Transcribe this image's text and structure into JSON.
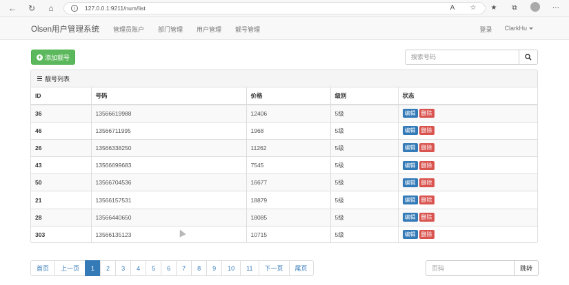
{
  "browser": {
    "url": "127.0.0.1:9211/num/list"
  },
  "navbar": {
    "brand": "Olsen用户管理系统",
    "links": [
      "管理员账户",
      "部门管理",
      "用户管理",
      "靓号管理"
    ],
    "login": "登录",
    "user": "ClarkHu"
  },
  "toolbar": {
    "add_label": "添加靓号",
    "search_placeholder": "搜索号码"
  },
  "panel": {
    "title": "靓号列表"
  },
  "table": {
    "headers": [
      "ID",
      "号码",
      "价格",
      "级别",
      "状态"
    ],
    "edit_label": "编辑",
    "delete_label": "删除",
    "rows": [
      {
        "id": "36",
        "mobile": "13566619988",
        "price": "12406",
        "level": "5级"
      },
      {
        "id": "46",
        "mobile": "13566711995",
        "price": "1968",
        "level": "5级"
      },
      {
        "id": "26",
        "mobile": "13566338250",
        "price": "11262",
        "level": "5级"
      },
      {
        "id": "43",
        "mobile": "13566699683",
        "price": "7545",
        "level": "5级"
      },
      {
        "id": "50",
        "mobile": "13566704536",
        "price": "16677",
        "level": "5级"
      },
      {
        "id": "21",
        "mobile": "13566157531",
        "price": "18879",
        "level": "5级"
      },
      {
        "id": "28",
        "mobile": "13566440650",
        "price": "18085",
        "level": "5级"
      },
      {
        "id": "303",
        "mobile": "13566135123",
        "price": "10715",
        "level": "5级"
      }
    ]
  },
  "pagination": {
    "first": "首页",
    "prev": "上一页",
    "pages": [
      "1",
      "2",
      "3",
      "4",
      "5",
      "6",
      "7",
      "8",
      "9",
      "10",
      "11"
    ],
    "active_page": "1",
    "next": "下一页",
    "last": "尾页",
    "jump_placeholder": "页码",
    "jump_label": "跳转"
  }
}
